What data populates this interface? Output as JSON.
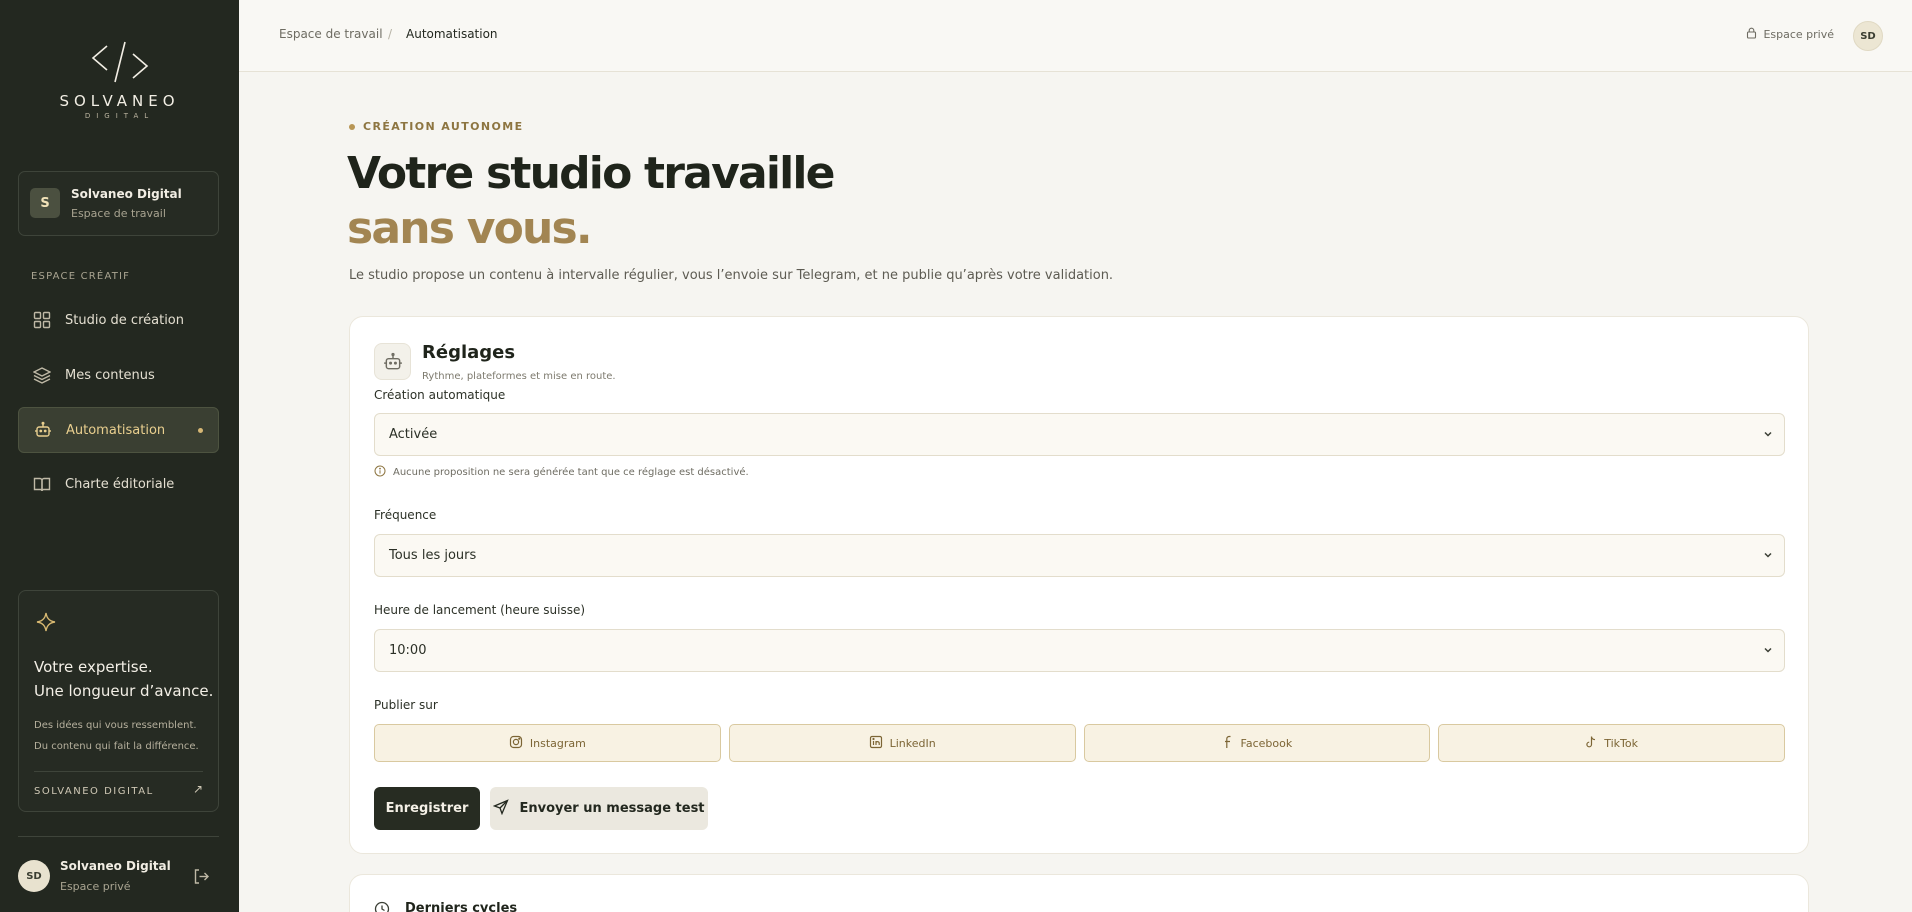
{
  "sidebar": {
    "brand": {
      "name": "SOLVANEO",
      "sub": "DIGITAL"
    },
    "workspace": {
      "initial": "S",
      "name": "Solvaneo Digital",
      "sub": "Espace de travail"
    },
    "section_label": "ESPACE CRÉATIF",
    "nav": [
      {
        "label": "Studio de création",
        "icon": "grid-icon",
        "active": false
      },
      {
        "label": "Mes contenus",
        "icon": "layers-icon",
        "active": false
      },
      {
        "label": "Automatisation",
        "icon": "robot-icon",
        "active": true
      },
      {
        "label": "Charte éditoriale",
        "icon": "book-icon",
        "active": false
      }
    ],
    "promo": {
      "title_line1": "Votre expertise.",
      "title_line2": "Une longueur d’avance.",
      "text_line1": "Des idées qui vous ressemblent.",
      "text_line2": "Du contenu qui fait la différence.",
      "brand": "SOLVANEO DIGITAL",
      "arrow": "↗"
    },
    "user": {
      "initials": "SD",
      "name": "Solvaneo Digital",
      "sub": "Espace privé"
    }
  },
  "topbar": {
    "breadcrumb": [
      "Espace de travail",
      "Automatisation"
    ],
    "breadcrumb_sep": "/",
    "private_label": "Espace privé",
    "avatar_initials": "SD"
  },
  "hero": {
    "eyebrow": "CRÉATION AUTONOME",
    "title_line1": "Votre studio travaille",
    "title_line2": "sans vous.",
    "lead": "Le studio propose un contenu à intervalle régulier, vous l’envoie sur Telegram, et ne publie qu’après votre validation."
  },
  "settings": {
    "title": "Réglages",
    "subtitle": "Rythme, plateformes et mise en route.",
    "auto_label": "Création automatique",
    "auto_value": "Activée",
    "auto_hint": "Aucune proposition ne sera générée tant que ce réglage est désactivé.",
    "freq_label": "Fréquence",
    "freq_value": "Tous les jours",
    "time_label": "Heure de lancement (heure suisse)",
    "time_value": "10:00",
    "publish_label": "Publier sur",
    "platforms": [
      "Instagram",
      "LinkedIn",
      "Facebook",
      "TikTok"
    ],
    "save_label": "Enregistrer",
    "test_label": "Envoyer un message test"
  },
  "cycles": {
    "title": "Derniers cycles"
  },
  "colors": {
    "sidebar_bg": "#232820",
    "accent_gold": "#a28552",
    "active_nav": "#e9cf8f"
  }
}
